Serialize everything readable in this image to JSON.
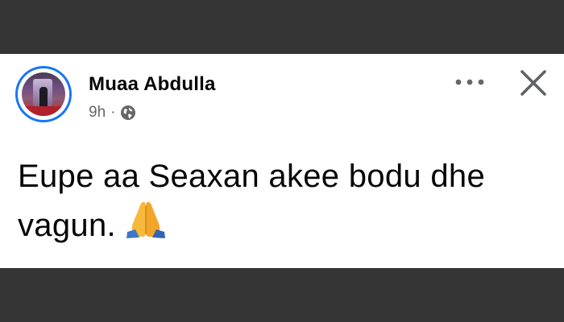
{
  "post": {
    "author": "Muaa Abdulla",
    "time": "9h",
    "separator": "·",
    "audience_icon": "globe-icon",
    "text": "Eupe aa Seaxan akee bodu dhe vagun.",
    "emoji": "folded-hands-emoji",
    "more_icon": "more-horizontal-icon",
    "close_icon": "close-icon"
  },
  "colors": {
    "background": "#353535",
    "card": "#ffffff",
    "text": "#050505",
    "secondary_text": "#65676b",
    "avatar_ring": "#1877f2"
  }
}
